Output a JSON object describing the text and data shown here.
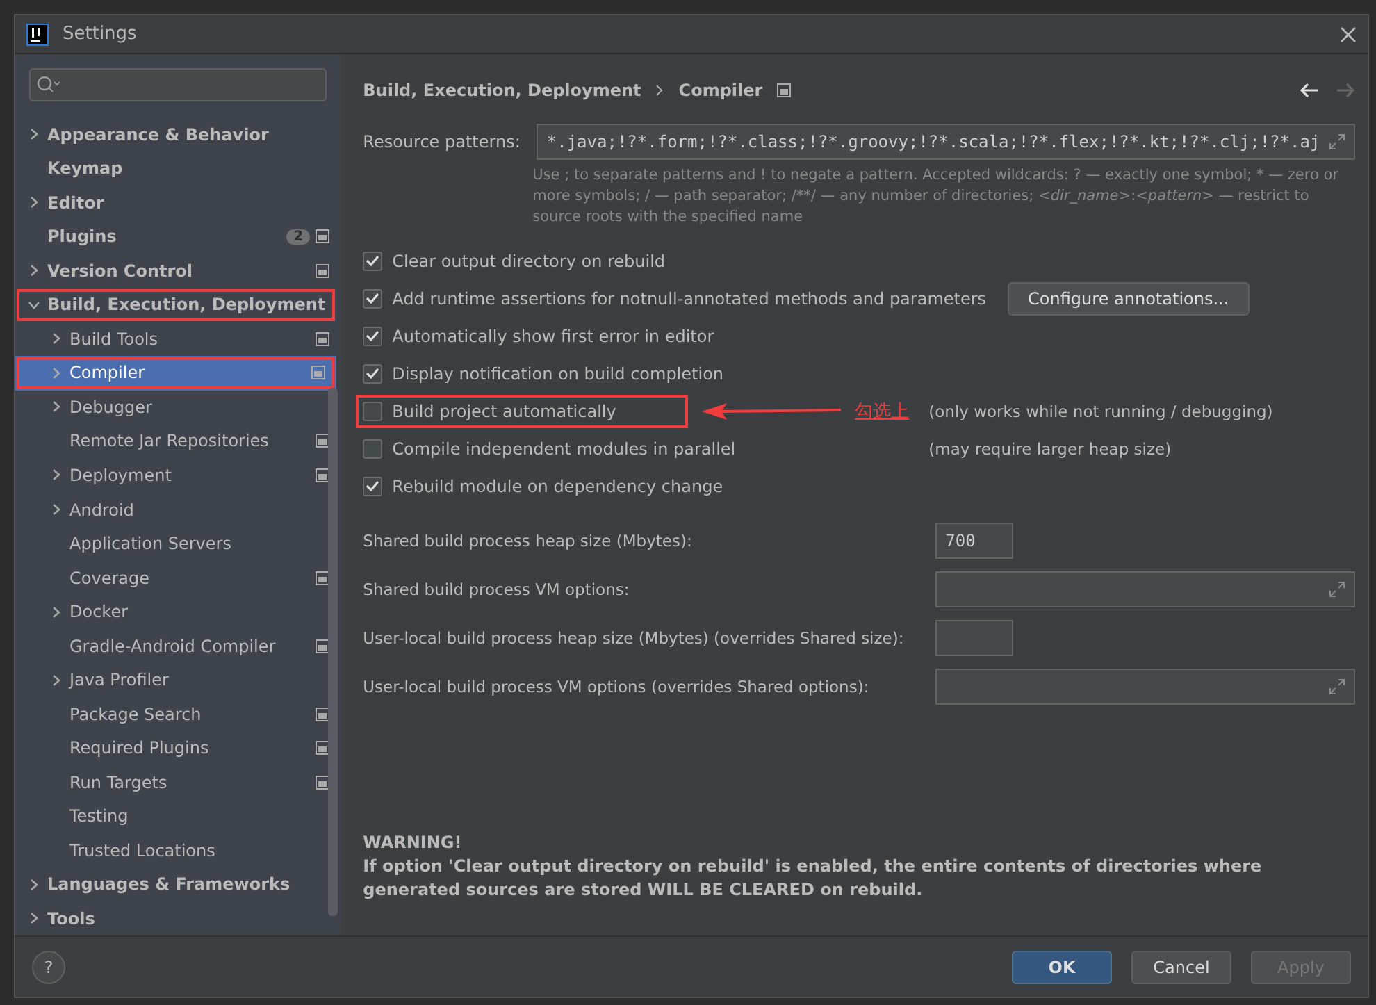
{
  "window": {
    "title": "Settings"
  },
  "sidebar": {
    "items": [
      {
        "label": "Appearance & Behavior",
        "expandable": true,
        "expanded": false,
        "selected": false,
        "bold": true
      },
      {
        "label": "Keymap",
        "expandable": false,
        "selected": false,
        "bold": true
      },
      {
        "label": "Editor",
        "expandable": true,
        "expanded": false,
        "selected": false,
        "bold": true
      },
      {
        "label": "Plugins",
        "expandable": false,
        "selected": false,
        "bold": true,
        "badge": "2",
        "project_icon": true
      },
      {
        "label": "Version Control",
        "expandable": true,
        "expanded": false,
        "selected": false,
        "bold": true,
        "project_icon": true
      },
      {
        "label": "Build, Execution, Deployment",
        "expandable": true,
        "expanded": true,
        "selected": false,
        "bold": true,
        "marked": true,
        "children": [
          {
            "label": "Build Tools",
            "expandable": true,
            "expanded": false,
            "selected": false,
            "project_icon": true
          },
          {
            "label": "Compiler",
            "expandable": true,
            "expanded": false,
            "selected": true,
            "marked": true,
            "project_icon": true
          },
          {
            "label": "Debugger",
            "expandable": true,
            "expanded": false,
            "selected": false
          },
          {
            "label": "Remote Jar Repositories",
            "expandable": false,
            "selected": false,
            "project_icon": true
          },
          {
            "label": "Deployment",
            "expandable": true,
            "expanded": false,
            "selected": false,
            "project_icon": true
          },
          {
            "label": "Android",
            "expandable": true,
            "expanded": false,
            "selected": false
          },
          {
            "label": "Application Servers",
            "expandable": false,
            "selected": false
          },
          {
            "label": "Coverage",
            "expandable": false,
            "selected": false,
            "project_icon": true
          },
          {
            "label": "Docker",
            "expandable": true,
            "expanded": false,
            "selected": false
          },
          {
            "label": "Gradle-Android Compiler",
            "expandable": false,
            "selected": false,
            "project_icon": true
          },
          {
            "label": "Java Profiler",
            "expandable": true,
            "expanded": false,
            "selected": false
          },
          {
            "label": "Package Search",
            "expandable": false,
            "selected": false,
            "project_icon": true
          },
          {
            "label": "Required Plugins",
            "expandable": false,
            "selected": false,
            "project_icon": true
          },
          {
            "label": "Run Targets",
            "expandable": false,
            "selected": false,
            "project_icon": true
          },
          {
            "label": "Testing",
            "expandable": false,
            "selected": false
          },
          {
            "label": "Trusted Locations",
            "expandable": false,
            "selected": false
          }
        ]
      },
      {
        "label": "Languages & Frameworks",
        "expandable": true,
        "expanded": false,
        "selected": false,
        "bold": true
      },
      {
        "label": "Tools",
        "expandable": true,
        "expanded": false,
        "selected": false,
        "bold": true
      }
    ]
  },
  "breadcrumb": [
    "Build, Execution, Deployment",
    "Compiler"
  ],
  "navigation": {
    "back_enabled": true,
    "forward_enabled": false
  },
  "resource_patterns": {
    "label": "Resource patterns:",
    "value": "*.java;!?*.form;!?*.class;!?*.groovy;!?*.scala;!?*.flex;!?*.kt;!?*.clj;!?*.aj",
    "hint": "Use ; to separate patterns and ! to negate a pattern. Accepted wildcards: ? — exactly one symbol; * — zero or more symbols; / — path separator; /**/ — any number of directories; *<dir_name>*:*<pattern>* — restrict to source roots with the specified name"
  },
  "options": [
    {
      "label": "Clear output directory on rebuild",
      "checked": true
    },
    {
      "label": "Add runtime assertions for notnull-annotated methods and parameters",
      "checked": true,
      "button": "Configure annotations..."
    },
    {
      "label": "Automatically show first error in editor",
      "checked": true
    },
    {
      "label": "Display notification on build completion",
      "checked": true
    },
    {
      "label": "Build project automatically",
      "checked": false,
      "marked": true,
      "annotation": "勾选上",
      "note": "(only works while not running / debugging)"
    },
    {
      "label": "Compile independent modules in parallel",
      "checked": false,
      "note": "(may require larger heap size)"
    },
    {
      "label": "Rebuild module on dependency change",
      "checked": true
    }
  ],
  "fields": [
    {
      "kind": "short",
      "label": "Shared build process heap size (Mbytes):",
      "value": "700"
    },
    {
      "kind": "expandable",
      "label": "Shared build process VM options:"
    },
    {
      "kind": "tiny",
      "label": "User-local build process heap size (Mbytes) (overrides Shared size):"
    },
    {
      "kind": "expandable",
      "label": "User-local build process VM options (overrides Shared options):"
    }
  ],
  "warning": {
    "title": "WARNING!",
    "text": "If option 'Clear output directory on rebuild' is enabled, the entire contents of directories where generated sources are stored WILL BE CLEARED on rebuild."
  },
  "help": "?",
  "buttons": [
    {
      "label": "OK",
      "kind": "primary",
      "disabled": false
    },
    {
      "label": "Cancel",
      "kind": "normal",
      "disabled": false
    },
    {
      "label": "Apply",
      "kind": "normal",
      "disabled": true
    }
  ]
}
